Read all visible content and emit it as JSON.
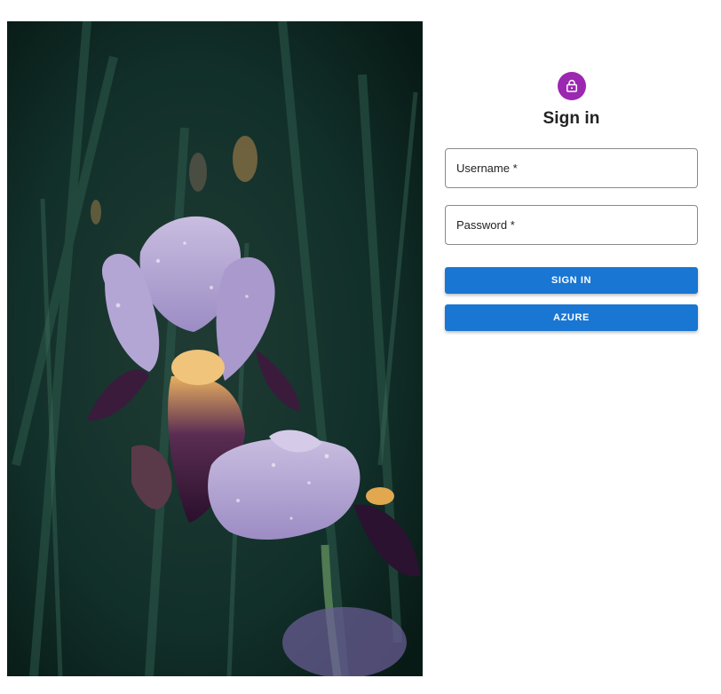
{
  "colors": {
    "accent": "#1976d2",
    "avatar": "#9c27b0",
    "hero_background": "#0d2420"
  },
  "hero": {
    "icon": "iris-flower-photo"
  },
  "form": {
    "avatar_icon": "lock-icon",
    "title": "Sign in",
    "username_label": "Username *",
    "password_label": "Password *",
    "signin_label": "SIGN IN",
    "azure_label": "AZURE"
  }
}
